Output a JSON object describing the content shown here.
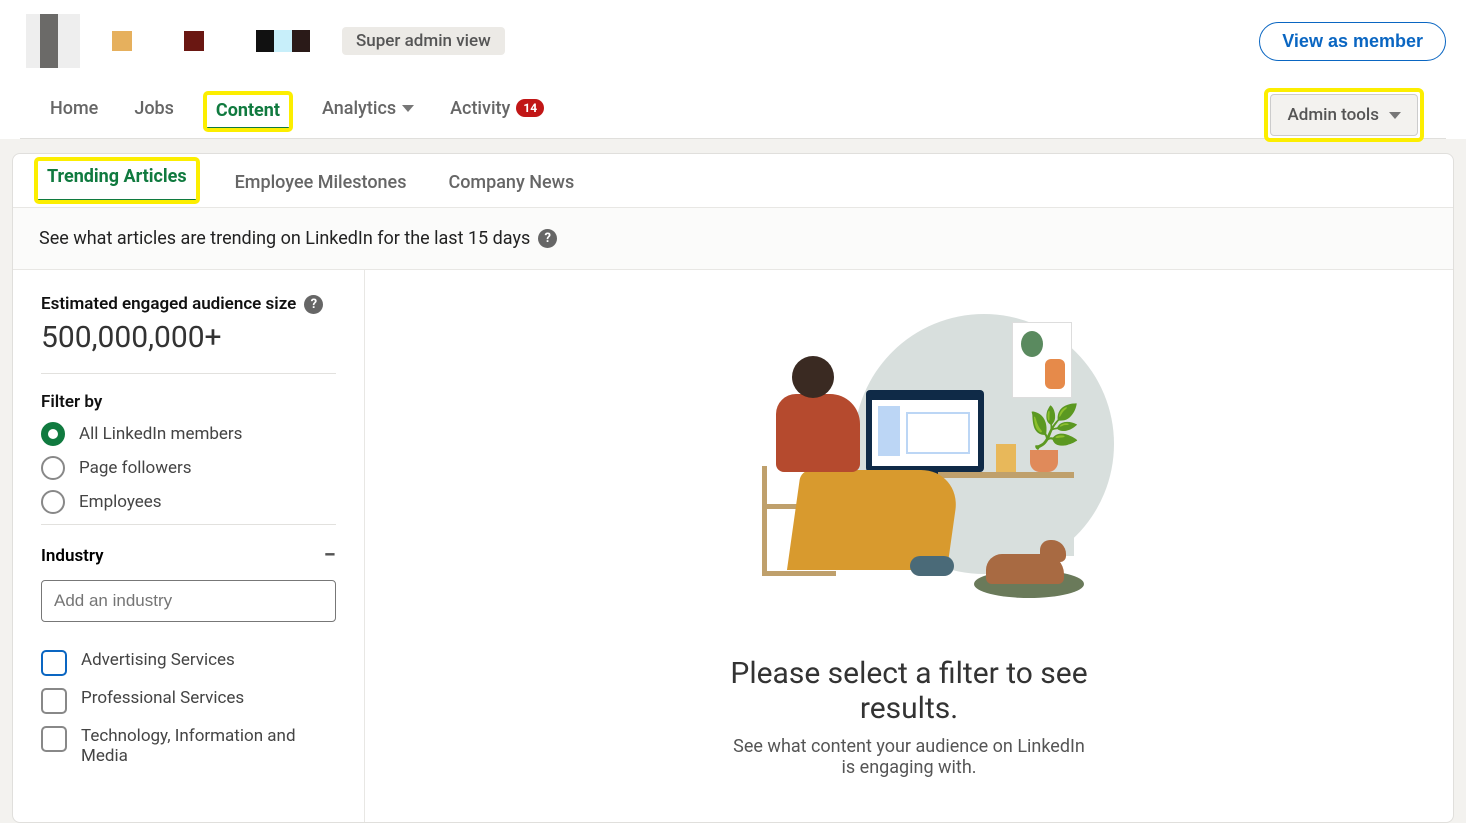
{
  "header": {
    "admin_badge": "Super admin view",
    "view_member": "View as member"
  },
  "nav": {
    "home": "Home",
    "jobs": "Jobs",
    "content": "Content",
    "analytics": "Analytics",
    "activity": "Activity",
    "activity_count": "14",
    "admin_tools": "Admin tools"
  },
  "subtabs": {
    "trending": "Trending Articles",
    "milestones": "Employee Milestones",
    "news": "Company News"
  },
  "desc": "See what articles are trending on LinkedIn for the last 15 days",
  "filters": {
    "audience_label": "Estimated engaged audience size",
    "audience_value": "500,000,000+",
    "filter_by": "Filter by",
    "radio_all": "All LinkedIn members",
    "radio_followers": "Page followers",
    "radio_employees": "Employees",
    "industry_label": "Industry",
    "industry_placeholder": "Add an industry",
    "industries": {
      "0": "Advertising Services",
      "1": "Professional Services",
      "2": "Technology, Information and Media"
    }
  },
  "empty": {
    "title": "Please select a filter to see results.",
    "sub": "See what content your audience on LinkedIn is engaging with."
  }
}
